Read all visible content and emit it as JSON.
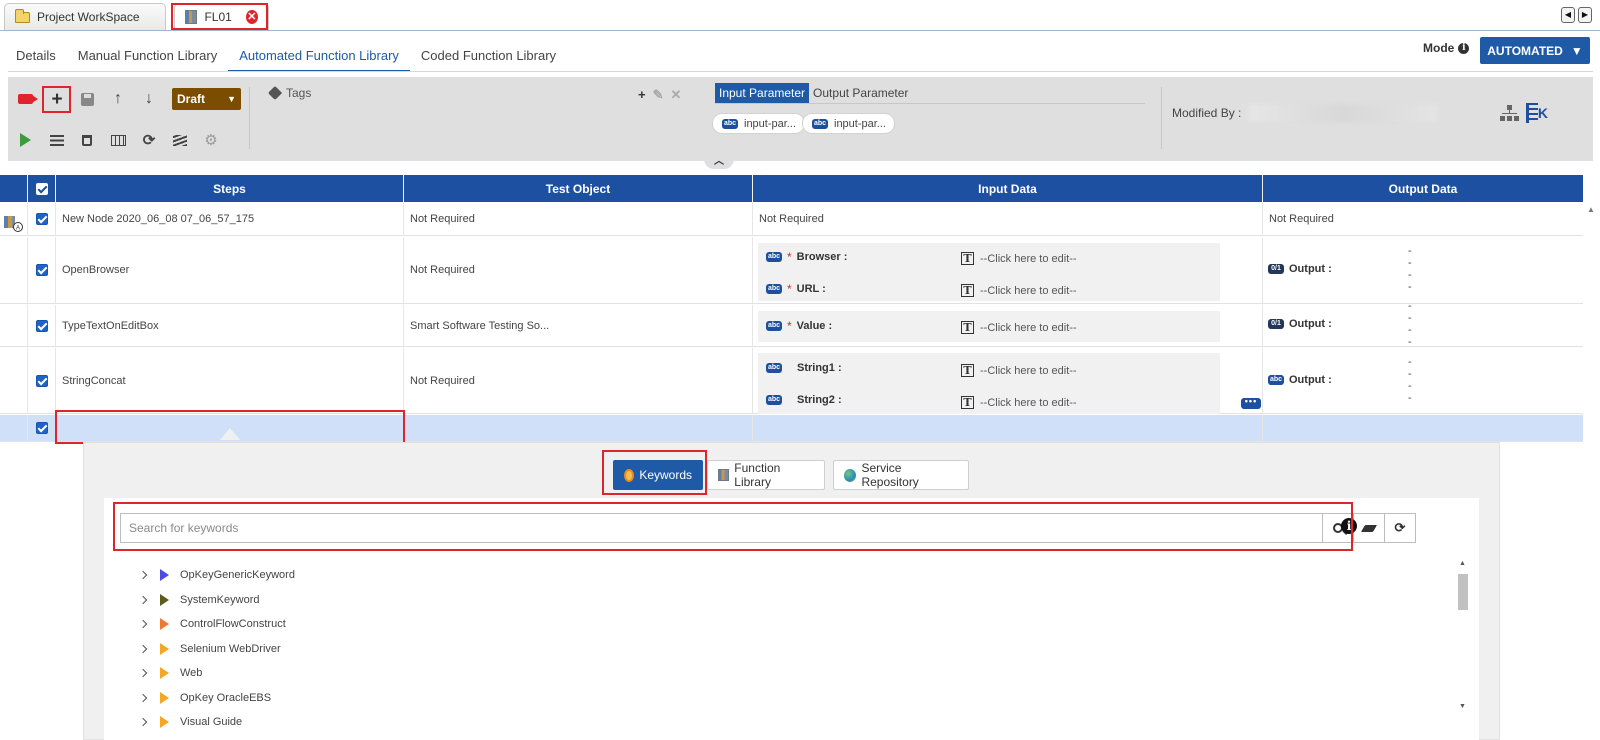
{
  "doc_tabs": [
    {
      "label": "Project WorkSpace"
    },
    {
      "label": "FL01"
    }
  ],
  "sub_tabs": [
    {
      "label": "Details"
    },
    {
      "label": "Manual Function Library"
    },
    {
      "label": "Automated Function Library",
      "active": true
    },
    {
      "label": "Coded Function Library"
    }
  ],
  "mode": {
    "label": "Mode",
    "value": "AUTOMATED"
  },
  "toolbar": {
    "status": "Draft",
    "tags_label": "Tags",
    "param_tabs": [
      "Input Parameter",
      "Output Parameter"
    ],
    "chips": [
      "input-par...",
      "input-par..."
    ],
    "modified_by_label": "Modified By :"
  },
  "grid": {
    "columns": [
      "Steps",
      "Test Object",
      "Input Data",
      "Output Data"
    ],
    "rows": [
      {
        "step": "New Node 2020_06_08 07_06_57_175",
        "test_object": "Not Required",
        "input": "Not Required",
        "output": "Not Required"
      },
      {
        "step": "OpenBrowser",
        "test_object": "Not Required",
        "params": [
          {
            "name": "Browser :",
            "req": "*",
            "val": "--Click here to edit--"
          },
          {
            "name": "URL :",
            "req": "*",
            "val": "--Click here to edit--"
          }
        ],
        "output_label": "Output :",
        "output_value": "----"
      },
      {
        "step": "TypeTextOnEditBox",
        "test_object": "Smart Software Testing So...",
        "params": [
          {
            "name": "Value :",
            "req": "*",
            "val": "--Click here to edit--"
          }
        ],
        "output_label": "Output :",
        "output_value": "----"
      },
      {
        "step": "StringConcat",
        "test_object": "Not Required",
        "params": [
          {
            "name": "String1 :",
            "req": "",
            "val": "--Click here to edit--"
          },
          {
            "name": "String2 :",
            "req": "",
            "val": "--Click here to edit--"
          }
        ],
        "output_label": "Output :",
        "output_value": "----"
      }
    ]
  },
  "keyword_panel": {
    "tabs": [
      "Keywords",
      "Function Library",
      "Service Repository"
    ],
    "search_placeholder": "Search for keywords",
    "tree": [
      {
        "label": "OpKeyGenericKeyword",
        "color": "#4b4be6"
      },
      {
        "label": "SystemKeyword",
        "color": "#5b5b1a"
      },
      {
        "label": "ControlFlowConstruct",
        "color": "#f07a30"
      },
      {
        "label": "Selenium WebDriver",
        "color": "#f5a623"
      },
      {
        "label": "Web",
        "color": "#f5a623"
      },
      {
        "label": "OpKey OracleEBS",
        "color": "#f5a623"
      },
      {
        "label": "Visual Guide",
        "color": "#f5a623"
      }
    ]
  },
  "colors": {
    "brand": "#1d50a0",
    "accent": "#1f5aa6",
    "highlight": "#e0242b",
    "draft": "#7a4d00"
  }
}
